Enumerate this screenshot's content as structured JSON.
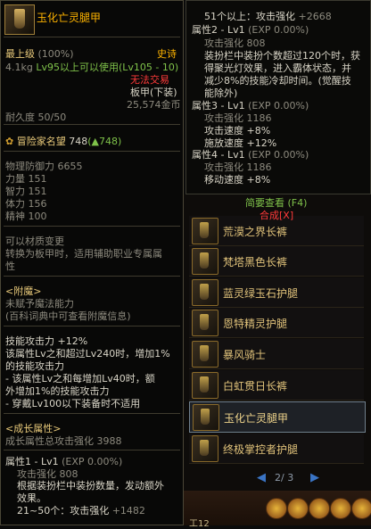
{
  "item": {
    "name": "玉化亡灵腿甲",
    "level_label": "最上级",
    "level_pct": "(100%)",
    "rarity": "史诗",
    "weight": "4.1kg",
    "level_req": "Lv95以上可以使用(Lv105 - 10)",
    "trade": "无法交易",
    "slot": "板甲(下装)",
    "price": "25,574金币",
    "durability": "耐久度 50/50",
    "fame_label": "冒险家名望",
    "fame_value": "748",
    "fame_diff": "(▲748)",
    "stats": [
      "物理防御力 6655",
      "力量 151",
      "智力 151",
      "体力 156",
      "精神 100"
    ],
    "transfer": [
      "可以材质变更",
      "转换为板甲时，适用辅助职业专属属",
      "性"
    ],
    "enchant_title": "<附魔>",
    "enchant_lines": [
      "未赋予魔法能力",
      "(百科词典中可查看附魔信息)"
    ],
    "skill_lines": [
      "技能攻击力 +12%",
      "该属性Lv之和超过Lv240时，增加1%",
      "的技能攻击力",
      "- 该属性Lv之和每增加Lv40时，额",
      "外增加1%的技能攻击力",
      "- 穿戴Lv100以下装备时不适用"
    ],
    "growth_title": "<成长属性>",
    "growth_total_label": "成长属性总攻击强化",
    "growth_total_value": "3988",
    "prop1_title": "属性1 - Lv1",
    "prop1_exp": "(EXP 0.00%)",
    "prop1_attack": "攻击强化 808",
    "prop1_desc": [
      "根据装扮栏中装扮数量，发动额外",
      "效果。"
    ],
    "prop1_tier": "21~50个：攻击强化",
    "prop1_tier_value": "+1482"
  },
  "tooltip2": {
    "line1": "51个以上：攻击强化",
    "line1_value": "+2668",
    "p2_title": "属性2 - Lv1",
    "p2_exp": "(EXP 0.00%)",
    "p2_attack": "攻击强化 808",
    "p2_desc": [
      "装扮栏中装扮个数超过120个时，获",
      "得聚光灯效果，进入霸体状态，并",
      "减少8%的技能冷却时间。(觉醒技",
      "能除外)"
    ],
    "p3_title": "属性3 - Lv1",
    "p3_exp": "(EXP 0.00%)",
    "p3_lines": [
      "攻击强化 1186",
      "攻击速度 +8%",
      "施放速度 +12%"
    ],
    "p4_title": "属性4 - Lv1",
    "p4_exp": "(EXP 0.00%)",
    "p4_lines": [
      "攻击强化 1186",
      "移动速度 +8%"
    ],
    "brief_view": "简要查看 (F4)",
    "synthesize": "合成[X]"
  },
  "equipment_list": [
    {
      "label": "荒漠之界长裤",
      "selected": false
    },
    {
      "label": "梵塔黑色长裤",
      "selected": false
    },
    {
      "label": "蓝灵绿玉石护腿",
      "selected": false
    },
    {
      "label": "恩特精灵护腿",
      "selected": false
    },
    {
      "label": "暴风骑士",
      "selected": false
    },
    {
      "label": "白虹贯日长裤",
      "selected": false
    },
    {
      "label": "玉化亡灵腿甲",
      "selected": true
    },
    {
      "label": "终极掌控者护腿",
      "selected": false
    }
  ],
  "pager": {
    "text": "2/ 3",
    "prev": "◀",
    "next": "▶"
  },
  "hotkey": "工12",
  "colors": {
    "gold": "#e8c97a",
    "epic": "#ffb400",
    "red": "#ff3a3a",
    "green": "#7fc24a",
    "accent_blue": "#3a74c4"
  }
}
